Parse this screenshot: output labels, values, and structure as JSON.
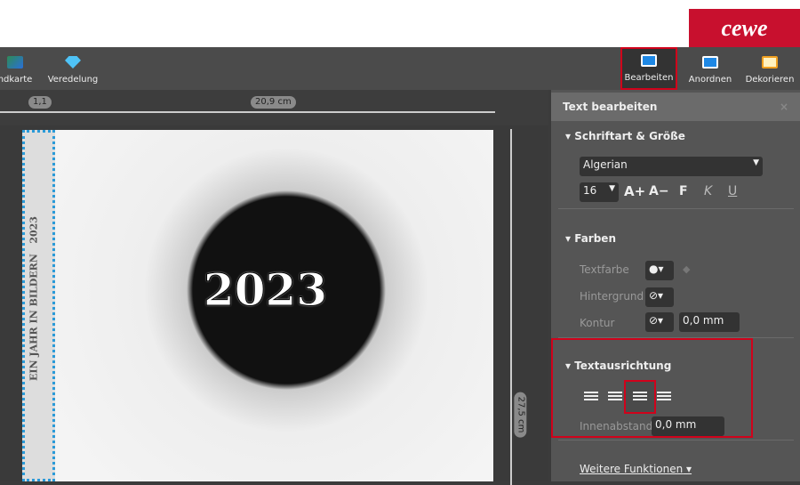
{
  "brand": {
    "logo": "cewe",
    "color": "#c8102e"
  },
  "toolbar": {
    "items": [
      {
        "label": "ndkarte",
        "icon": "map-icon"
      },
      {
        "label": "Veredelung",
        "icon": "diamond-icon"
      },
      {
        "label": "Bearbeiten",
        "icon": "edit-icon",
        "active": true
      },
      {
        "label": "Anordnen",
        "icon": "arrange-icon"
      },
      {
        "label": "Dekorieren",
        "icon": "frame-icon"
      }
    ]
  },
  "ruler": {
    "spine": "1,1",
    "width": "20,9 cm",
    "height": "27,5 cm"
  },
  "page": {
    "title": "2023",
    "spine_text": "EIN JAHR IN BILDERN   2023"
  },
  "panel": {
    "title": "Text bearbeiten",
    "close": "×",
    "font_section": "Schriftart & Größe",
    "font": "Algerian",
    "size": "16",
    "grow": "A+",
    "shrink": "A−",
    "bold": "F",
    "italic": "K",
    "underline": "U",
    "colors_section": "Farben",
    "text_color": "Textfarbe",
    "background": "Hintergrund",
    "outline": "Kontur",
    "outline_value": "0,0 mm",
    "align_section": "Textausrichtung",
    "align_selected": "right",
    "padding_label": "Innenabstand",
    "padding_value": "0,0 mm",
    "more": "Weitere Funktionen"
  }
}
